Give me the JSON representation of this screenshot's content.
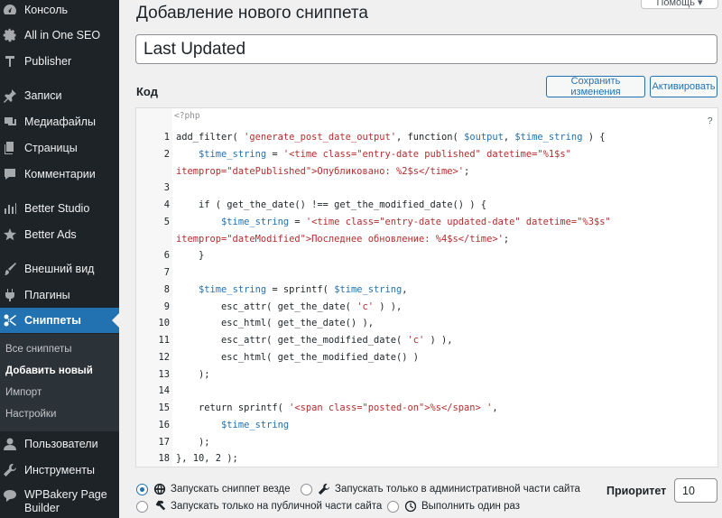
{
  "sidebar": {
    "items": [
      {
        "label": "Консоль",
        "icon": "dashboard-icon"
      },
      {
        "label": "All in One SEO",
        "icon": "gear-icon"
      },
      {
        "label": "Publisher",
        "icon": "publisher-icon"
      },
      {
        "label": "Записи",
        "icon": "pin-icon"
      },
      {
        "label": "Медиафайлы",
        "icon": "media-icon"
      },
      {
        "label": "Страницы",
        "icon": "pages-icon"
      },
      {
        "label": "Комментарии",
        "icon": "comment-icon"
      },
      {
        "label": "Better Studio",
        "icon": "chart-icon"
      },
      {
        "label": "Better Ads",
        "icon": "ads-icon"
      },
      {
        "label": "Внешний вид",
        "icon": "brush-icon"
      },
      {
        "label": "Плагины",
        "icon": "plugin-icon"
      },
      {
        "label": "Сниппеты",
        "icon": "scissors-icon"
      },
      {
        "label": "Пользователи",
        "icon": "user-icon"
      },
      {
        "label": "Инструменты",
        "icon": "wrench-icon"
      },
      {
        "label": "WPBakery Page Builder",
        "icon": "wpbakery-icon"
      }
    ],
    "submenu": [
      "Все сниппеты",
      "Добавить новый",
      "Импорт",
      "Настройки"
    ]
  },
  "header": {
    "title": "Добавление нового сниппета",
    "help_tab": "Помощь ▾"
  },
  "snippet": {
    "title_value": "Last Updated",
    "code_label": "Код",
    "save_button": "Сохранить изменения",
    "activate_button": "Активировать"
  },
  "editor": {
    "php_tag": "<?php",
    "help_mark": "?",
    "lines": [
      {
        "n": "1",
        "text": "add_filter( 'generate_post_date_output', function( $output, $time_string ) {"
      },
      {
        "n": "2",
        "text": "    $time_string = '<time class=\"entry-date published\" datetime=\"%1$s\""
      },
      {
        "n": "",
        "text": "itemprop=\"datePublished\">Опубликовано: %2$s</time>';"
      },
      {
        "n": "3",
        "text": ""
      },
      {
        "n": "4",
        "text": "    if ( get_the_date() !== get_the_modified_date() ) {"
      },
      {
        "n": "5",
        "text": "        $time_string = '<time class=\"entry-date updated-date\" datetime=\"%3$s\""
      },
      {
        "n": "",
        "text": "itemprop=\"dateModified\">Последнее обновление: %4$s</time>';"
      },
      {
        "n": "6",
        "text": "    }"
      },
      {
        "n": "7",
        "text": ""
      },
      {
        "n": "8",
        "text": "    $time_string = sprintf( $time_string,"
      },
      {
        "n": "9",
        "text": "        esc_attr( get_the_date( 'c' ) ),"
      },
      {
        "n": "10",
        "text": "        esc_html( get_the_date() ),"
      },
      {
        "n": "11",
        "text": "        esc_attr( get_the_modified_date( 'c' ) ),"
      },
      {
        "n": "12",
        "text": "        esc_html( get_the_modified_date() )"
      },
      {
        "n": "13",
        "text": "    );"
      },
      {
        "n": "14",
        "text": ""
      },
      {
        "n": "15",
        "text": "    return sprintf( '<span class=\"posted-on\">%s</span> ',"
      },
      {
        "n": "16",
        "text": "        $time_string"
      },
      {
        "n": "17",
        "text": "    );"
      },
      {
        "n": "18",
        "text": "}, 10, 2 );"
      }
    ]
  },
  "scope": {
    "everywhere": "Запускать сниппет везде",
    "admin_only": "Запускать только в административной части сайта",
    "front_only": "Запускать только на публичной части сайта",
    "once": "Выполнить один раз",
    "selected": "everywhere"
  },
  "priority": {
    "label": "Приоритет",
    "value": "10"
  },
  "colors": {
    "sidebar_bg": "#1d2327",
    "accent": "#2271b1",
    "string": "#b32d2e"
  }
}
